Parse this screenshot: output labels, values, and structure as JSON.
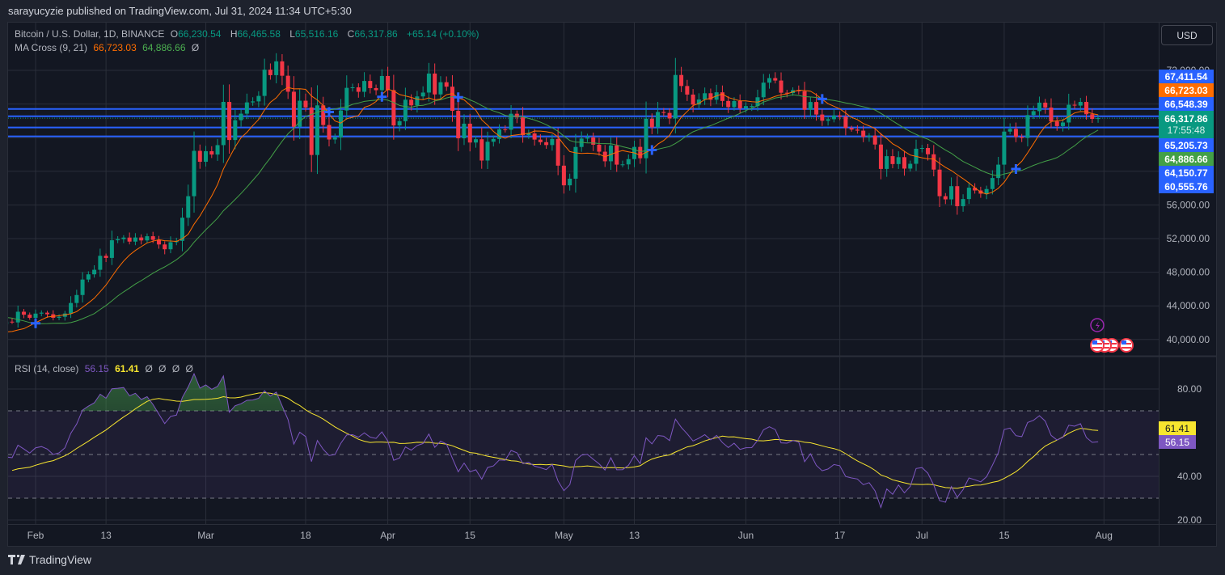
{
  "publish_line": "sarayucyzie published on TradingView.com, Jul 31, 2024 11:34 UTC+5:30",
  "legend": {
    "symbol": "Bitcoin / U.S. Dollar, 1D, BINANCE",
    "open_label": "O",
    "open": "66,230.54",
    "high_label": "H",
    "high": "66,465.58",
    "low_label": "L",
    "low": "65,516.16",
    "close_label": "C",
    "close": "66,317.86",
    "change": "+65.14 (+0.10%)",
    "ma_name": "MA Cross (9, 21)",
    "ma_fast": "66,723.03",
    "ma_slow": "64,886.66",
    "ma_extra": "Ø",
    "rsi_name": "RSI (14, close)",
    "rsi_value": "56.15",
    "rsi_ma": "61.41",
    "rsi_extra": [
      "Ø",
      "Ø",
      "Ø",
      "Ø"
    ]
  },
  "currency_button": "USD",
  "price_tags": [
    {
      "label": "67,411.54",
      "color": "#2962ff"
    },
    {
      "label": "66,723.03",
      "color": "#ff6d00"
    },
    {
      "label": "66,548.39",
      "color": "#2962ff"
    },
    {
      "label": "66,317.86",
      "sub": "17:55:48",
      "color": "#089981"
    },
    {
      "label": "65,205.73",
      "color": "#2962ff"
    },
    {
      "label": "64,886.66",
      "color": "#43a047"
    },
    {
      "label": "64,150.77",
      "color": "#2962ff"
    },
    {
      "label": "60,555.76",
      "color": "#2962ff"
    }
  ],
  "rsi_tags": [
    {
      "label": "61.41",
      "color": "#f7e52f",
      "text": "#131722"
    },
    {
      "label": "56.15",
      "color": "#7e57c2",
      "text": "#ffffff"
    }
  ],
  "brand": "TradingView",
  "colors": {
    "up": "#089981",
    "down": "#f23645",
    "ma_fast": "#ff6d00",
    "ma_slow": "#43a047",
    "level": "#2962ff",
    "rsi": "#7e57c2",
    "rsi_ma": "#f7e52f"
  },
  "chart_data": {
    "type": "candlestick",
    "title": "Bitcoin / U.S. Dollar, 1D, BINANCE",
    "start_date": "2024-01-01",
    "visible_from": "2024-01-27",
    "closes": [
      44180,
      44940,
      42840,
      44150,
      44160,
      43970,
      43930,
      46970,
      46120,
      46630,
      46340,
      42780,
      42840,
      41730,
      42510,
      43150,
      42740,
      41260,
      41620,
      41660,
      41550,
      39500,
      39890,
      40080,
      39930,
      41820,
      42120,
      42030,
      43300,
      42950,
      42580,
      43080,
      43190,
      43000,
      42580,
      42700,
      43090,
      44340,
      45290,
      47130,
      47750,
      48290,
      49950,
      49700,
      51800,
      51930,
      52120,
      51640,
      52130,
      51780,
      52280,
      51850,
      51300,
      50730,
      51570,
      51730,
      54480,
      57040,
      62430,
      61130,
      62390,
      61990,
      63110,
      68250,
      63720,
      66070,
      66850,
      68190,
      68310,
      68960,
      72080,
      71430,
      73070,
      71360,
      69460,
      65290,
      68390,
      67590,
      61940,
      67840,
      65500,
      63780,
      64040,
      67230,
      69920,
      69980,
      69450,
      70740,
      69890,
      69640,
      71330,
      69650,
      65450,
      65960,
      68510,
      67840,
      68900,
      69360,
      71620,
      69140,
      70590,
      70060,
      67190,
      63920,
      65660,
      63420,
      63810,
      61280,
      63510,
      63840,
      64990,
      64940,
      66840,
      66410,
      64300,
      64500,
      63770,
      63460,
      63120,
      63840,
      60670,
      58330,
      59120,
      62890,
      63890,
      64030,
      63160,
      62330,
      61190,
      63070,
      60790,
      60820,
      61450,
      62900,
      61550,
      66250,
      65230,
      67050,
      66940,
      66280,
      71450,
      70140,
      69120,
      67930,
      68530,
      69280,
      68510,
      69390,
      68360,
      67630,
      68350,
      67490,
      67750,
      67760,
      68800,
      70540,
      71080,
      70790,
      69340,
      69300,
      69650,
      69510,
      67320,
      68240,
      66750,
      66010,
      66190,
      66640,
      66490,
      65150,
      64960,
      64830,
      64100,
      64250,
      63180,
      60280,
      61800,
      60860,
      61680,
      60320,
      60890,
      62680,
      62770,
      62020,
      60200,
      57040,
      56660,
      58230,
      55850,
      56700,
      58050,
      57720,
      57340,
      57890,
      59200,
      60790,
      64720,
      65040,
      64090,
      63970,
      66680,
      67150,
      68160,
      67580,
      65930,
      65370,
      65800,
      67910,
      67810,
      68250,
      66780,
      66230,
      66317.86
    ],
    "indicators": {
      "ma_fast_period": 9,
      "ma_slow_period": 21,
      "rsi_period": 14,
      "rsi_ma_period": 14
    },
    "horizontal_levels": [
      67411.54,
      66548.39,
      65205.73,
      64150.77
    ],
    "price_axis": {
      "ticks": [
        "72,000.00",
        "68,000.00",
        "64,000.00",
        "60,000.00",
        "56,000.00",
        "52,000.00",
        "48,000.00",
        "44,000.00",
        "40,000.00"
      ],
      "values": [
        72000,
        68000,
        64000,
        60000,
        56000,
        52000,
        48000,
        44000,
        40000
      ]
    },
    "rsi_axis": {
      "ticks": [
        "80.00",
        "40.00",
        "20.00"
      ],
      "values": [
        80,
        40,
        20
      ],
      "bands": [
        30,
        50,
        70
      ]
    },
    "time_axis": [
      {
        "label": "Feb",
        "date": "2024-02-01"
      },
      {
        "label": "13",
        "date": "2024-02-13"
      },
      {
        "label": "Mar",
        "date": "2024-03-01"
      },
      {
        "label": "18",
        "date": "2024-03-18"
      },
      {
        "label": "Apr",
        "date": "2024-04-01"
      },
      {
        "label": "15",
        "date": "2024-04-15"
      },
      {
        "label": "May",
        "date": "2024-05-01"
      },
      {
        "label": "13",
        "date": "2024-05-13"
      },
      {
        "label": "Jun",
        "date": "2024-06-01"
      },
      {
        "label": "17",
        "date": "2024-06-17"
      },
      {
        "label": "Jul",
        "date": "2024-07-01"
      },
      {
        "label": "15",
        "date": "2024-07-15"
      },
      {
        "label": "Aug",
        "date": "2024-08-01"
      }
    ]
  }
}
